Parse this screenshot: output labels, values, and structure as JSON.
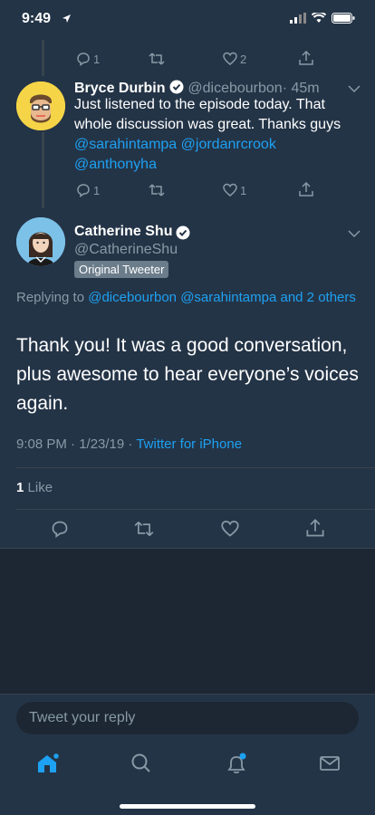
{
  "status": {
    "time": "9:49"
  },
  "prev_actions": {
    "reply_count": "1",
    "like_count": "2"
  },
  "tweet1": {
    "name": "Bryce Durbin",
    "handle": "@dicebourbon",
    "time": "· 45m",
    "text_l1": "Just listened to the episode today. That",
    "text_l2": "whole discussion was great. Thanks guys",
    "mention_1": "@sarahintampa",
    "mention_2": "@jordanrcrook",
    "mention_3": "@anthonyha",
    "reply_count": "1",
    "like_count": "1"
  },
  "tweet2": {
    "name": "Catherine Shu",
    "handle": "@CatherineShu",
    "badge": "Original Tweeter",
    "replying_prefix": "Replying to",
    "replying_m1": "@dicebourbon",
    "replying_m2": "@sarahintampa",
    "replying_m3": "and 2 others",
    "text": "Thank you! It was a good conversation, plus awesome to hear everyone’s voices again.",
    "timestamp": "9:08 PM · 1/23/19 ·",
    "source": "Twitter for iPhone",
    "like_count": "1",
    "like_label": "Like"
  },
  "compose": {
    "placeholder": "Tweet your reply"
  },
  "colors": {
    "accent": "#1da1f2",
    "background": "#243447",
    "muted": "#8899a6"
  }
}
